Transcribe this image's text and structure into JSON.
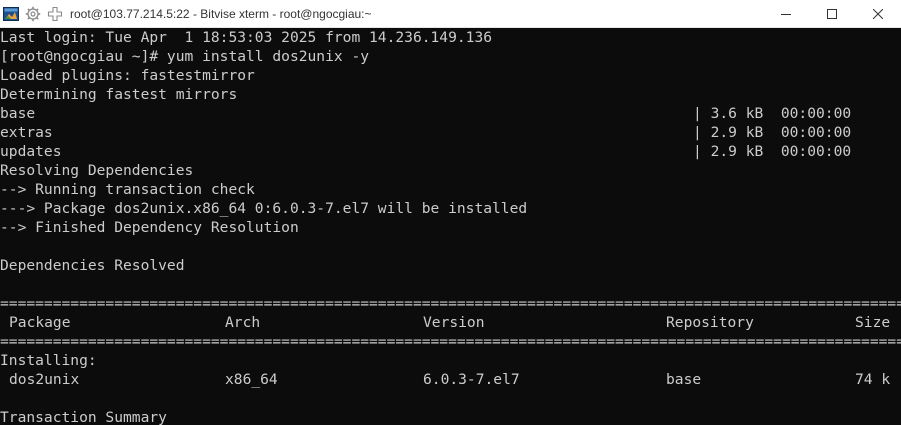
{
  "window": {
    "title": "root@103.77.214.5:22 - Bitvise xterm - root@ngocgiau:~",
    "app_icon": "bitvise-terminal-icon",
    "settings_icon": "gear-icon",
    "new_icon": "plus-icon",
    "controls": [
      "minimize-icon",
      "maximize-icon",
      "close-icon"
    ]
  },
  "terminal": {
    "lines": [
      "Last login: Tue Apr  1 18:53:03 2025 from 14.236.149.136",
      "[root@ngocgiau ~]# yum install dos2unix -y",
      "Loaded plugins: fastestmirror",
      "Determining fastest mirrors",
      "",
      "",
      "",
      "Resolving Dependencies",
      "--> Running transaction check",
      "---> Package dos2unix.x86_64 0:6.0.3-7.el7 will be installed",
      "--> Finished Dependency Resolution",
      "",
      "Dependencies Resolved",
      "",
      "============================================================================================================================",
      "",
      "============================================================================================================================",
      "Installing:",
      "",
      "",
      "Transaction Summary"
    ],
    "repos": [
      {
        "name": "base",
        "size": "| 3.6 kB  00:00:00"
      },
      {
        "name": "extras",
        "size": "| 2.9 kB  00:00:00"
      },
      {
        "name": "updates",
        "size": "| 2.9 kB  00:00:00"
      }
    ],
    "table": {
      "headers": [
        "Package",
        "Arch",
        "Version",
        "Repository",
        "Size"
      ],
      "row": [
        "dos2unix",
        "x86_64",
        "6.0.3-7.el7",
        "base",
        "74 k"
      ]
    }
  }
}
